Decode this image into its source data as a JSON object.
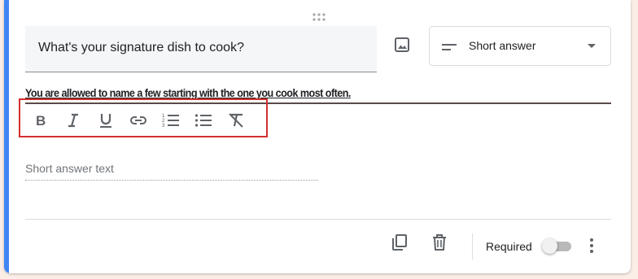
{
  "question": {
    "title": "What's your signature dish to cook?",
    "description": "You are allowed to name a few starting with the one you cook most often."
  },
  "type_select": {
    "selected": "Short answer"
  },
  "answer": {
    "placeholder": "Short answer text"
  },
  "footer": {
    "required_label": "Required",
    "required": false
  },
  "toolbar": {
    "buttons": [
      "bold-icon",
      "italic-icon",
      "underline-icon",
      "link-icon",
      "numbered-list-icon",
      "bulleted-list-icon",
      "clear-formatting-icon"
    ]
  },
  "colors": {
    "accent": "#4285f4",
    "highlight_border": "#d32f2f",
    "background": "#fbeee7"
  }
}
